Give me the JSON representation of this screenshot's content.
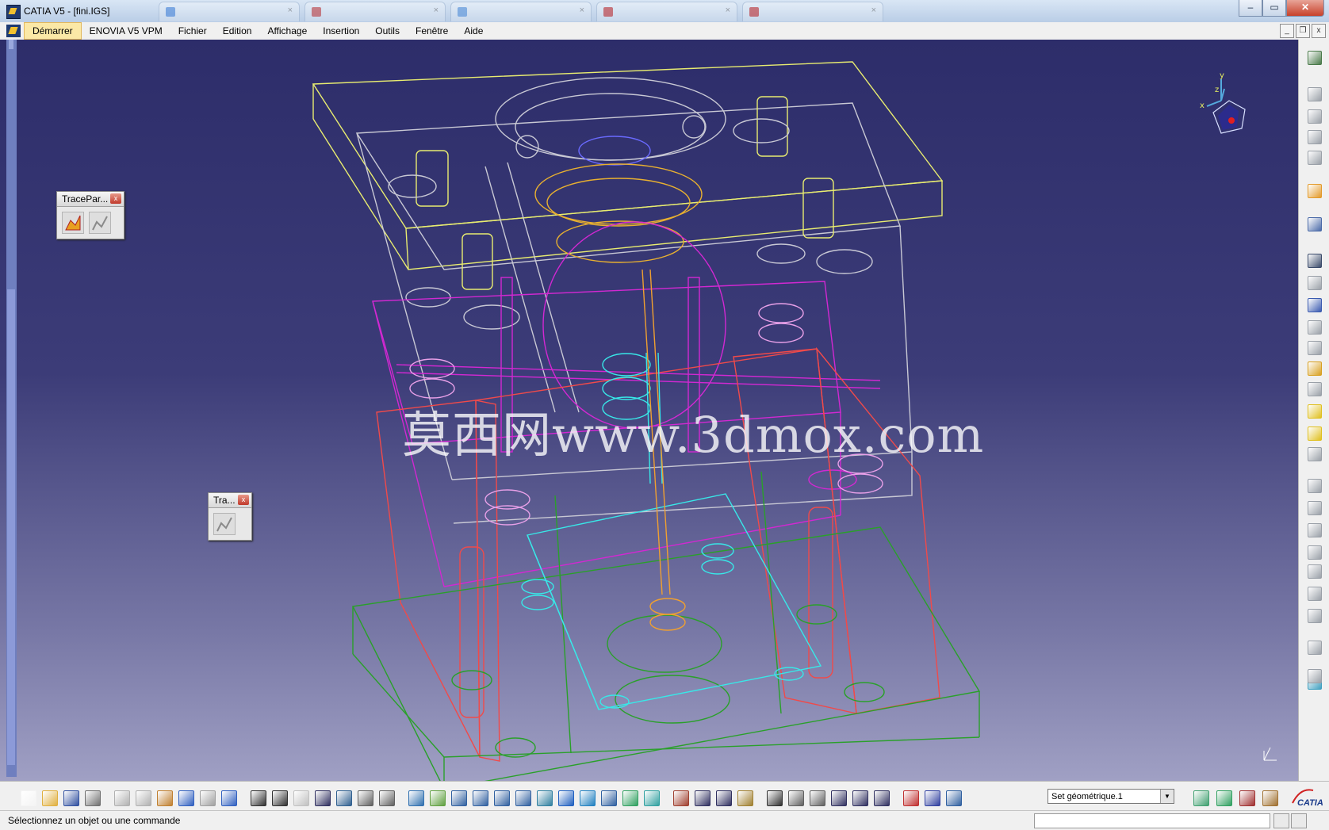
{
  "window": {
    "title": "CATIA V5 - [fini.IGS]",
    "tab_colors": [
      "#3b7dd8",
      "#c03030",
      "#4a8ad8",
      "#c02020",
      "#c02020"
    ],
    "controls": {
      "minimize": "–",
      "maximize": "▭",
      "close": "✕"
    }
  },
  "menu": {
    "items": [
      "Démarrer",
      "ENOVIA V5 VPM",
      "Fichier",
      "Edition",
      "Affichage",
      "Insertion",
      "Outils",
      "Fenêtre",
      "Aide"
    ],
    "active_index": 0,
    "mdi_controls": {
      "minimize": "_",
      "restore": "❐",
      "close": "x"
    }
  },
  "viewport": {
    "watermark": "莫西网www.3dmox.com",
    "compass_axes": {
      "x": "x",
      "y": "y",
      "z": "z"
    }
  },
  "floating_toolbars": [
    {
      "title": "TracePar...",
      "close": "x",
      "icons": [
        "trace-sketch-icon",
        "trace-profile-icon"
      ]
    },
    {
      "title": "Tra...",
      "close": "x",
      "icons": [
        "trace-profile-icon"
      ]
    }
  ],
  "right_toolbar": {
    "icons": [
      {
        "name": "gear-icon",
        "color": "#4a7a4a"
      },
      {
        "name": "tree-icon",
        "color": "#9aa0a8"
      },
      {
        "name": "tree-expand-icon",
        "color": "#9aa0a8"
      },
      {
        "name": "component-icon",
        "color": "#9aa0a8"
      },
      {
        "name": "assembly-icon",
        "color": "#9aa0a8"
      },
      {
        "name": "select-arrow-icon",
        "color": "#e39a2a"
      },
      {
        "name": "sketch-icon",
        "color": "#4a6aa8"
      },
      {
        "name": "pad-icon",
        "color": "#3a4a6a"
      },
      {
        "name": "pocket-icon",
        "color": "#9aa0a8"
      },
      {
        "name": "shaft-icon",
        "color": "#3a5ab0"
      },
      {
        "name": "groove-icon",
        "color": "#9aa0a8"
      },
      {
        "name": "hole-icon",
        "color": "#9aa0a8"
      },
      {
        "name": "rib-icon",
        "color": "#d8a020"
      },
      {
        "name": "slot-icon",
        "color": "#9aa0a8"
      },
      {
        "name": "cube-icon",
        "color": "#e0c020"
      },
      {
        "name": "fillet-icon",
        "color": "#e0c020"
      },
      {
        "name": "chamfer-icon",
        "color": "#9aa0a8"
      },
      {
        "name": "draft-icon",
        "color": "#9aa0a8"
      },
      {
        "name": "shell-icon",
        "color": "#9aa0a8"
      },
      {
        "name": "thickness-icon",
        "color": "#9aa0a8"
      },
      {
        "name": "thread-icon",
        "color": "#9aa0a8"
      },
      {
        "name": "mirror-icon",
        "color": "#9aa0a8"
      },
      {
        "name": "pattern-icon",
        "color": "#9aa0a8"
      },
      {
        "name": "sphere-icon",
        "color": "#9aa0a8"
      },
      {
        "name": "scale-icon",
        "color": "#9aa0a8"
      },
      {
        "name": "layers-icon",
        "color": "#40a0c0"
      },
      {
        "name": "analysis-icon",
        "color": "#9aa0a8"
      }
    ]
  },
  "bottom_toolbar": {
    "icons": [
      {
        "name": "new-icon",
        "color": "#f4f4f4"
      },
      {
        "name": "open-icon",
        "color": "#e0b040"
      },
      {
        "name": "save-icon",
        "color": "#3050a0"
      },
      {
        "name": "print-icon",
        "color": "#707070"
      },
      {
        "name": "cut-icon",
        "color": "#b0b0b0"
      },
      {
        "name": "copy-icon",
        "color": "#b0b0b0"
      },
      {
        "name": "paste-icon",
        "color": "#c08030"
      },
      {
        "name": "undo-icon",
        "color": "#3060c0"
      },
      {
        "name": "redo-icon",
        "color": "#a0a0a0"
      },
      {
        "name": "help-icon",
        "color": "#3060c0"
      },
      {
        "name": "formula-icon",
        "color": "#303030"
      },
      {
        "name": "comment-icon",
        "color": "#303030"
      },
      {
        "name": "lock-icon",
        "color": "#c0c0c0"
      },
      {
        "name": "table-icon",
        "color": "#303060"
      },
      {
        "name": "graph-icon",
        "color": "#306090"
      },
      {
        "name": "knowledge-icon",
        "color": "#606060"
      },
      {
        "name": "rule-icon",
        "color": "#606060"
      },
      {
        "name": "fly-mode-icon",
        "color": "#3070b0"
      },
      {
        "name": "fit-all-icon",
        "color": "#60a040"
      },
      {
        "name": "pan-icon",
        "color": "#3060a0"
      },
      {
        "name": "rotate-icon",
        "color": "#3060a0"
      },
      {
        "name": "zoom-in-icon",
        "color": "#3060a0"
      },
      {
        "name": "zoom-out-icon",
        "color": "#3060a0"
      },
      {
        "name": "normal-view-icon",
        "color": "#3080a0"
      },
      {
        "name": "multi-view-icon",
        "color": "#2060c0"
      },
      {
        "name": "iso-view-icon",
        "color": "#2080c0"
      },
      {
        "name": "shading-icon",
        "color": "#3060a0"
      },
      {
        "name": "hide-show-icon",
        "color": "#30a060"
      },
      {
        "name": "swap-visible-icon",
        "color": "#30a0a0"
      },
      {
        "name": "update-icon",
        "color": "#a04030"
      },
      {
        "name": "measure-between-icon",
        "color": "#303060"
      },
      {
        "name": "measure-item-icon",
        "color": "#303060"
      },
      {
        "name": "mass-icon",
        "color": "#a08030"
      },
      {
        "name": "camera-icon",
        "color": "#303030"
      },
      {
        "name": "refresh-icon",
        "color": "#606060"
      },
      {
        "name": "hand-icon",
        "color": "#606060"
      },
      {
        "name": "axis-system-icon",
        "color": "#303060"
      },
      {
        "name": "grid-icon",
        "color": "#303060"
      },
      {
        "name": "plane-icon",
        "color": "#303060"
      },
      {
        "name": "snap-icon",
        "color": "#c03030"
      },
      {
        "name": "constraint-icon",
        "color": "#3040a0"
      },
      {
        "name": "geometric-set-icon",
        "color": "#3060a0"
      }
    ],
    "geometric_set": "Set géométrique.1",
    "end_icons": [
      {
        "name": "surface-icon",
        "color": "#40a070"
      },
      {
        "name": "wireframe-icon",
        "color": "#30a060"
      },
      {
        "name": "analysis-view-icon",
        "color": "#a03030"
      },
      {
        "name": "tools-icon",
        "color": "#a07030"
      }
    ],
    "logo_text": "CATIA"
  },
  "status": {
    "message": "Sélectionnez un objet ou une commande"
  }
}
